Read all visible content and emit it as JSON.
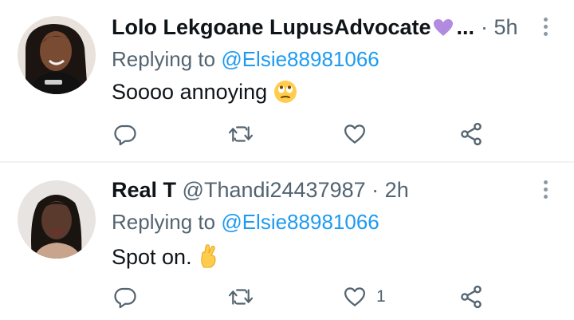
{
  "tweets": [
    {
      "display_name": "Lolo Lekgoane LupusAdvocate",
      "name_emoji": "purple-heart-emoji",
      "name_truncation": "...",
      "handle": "",
      "separator": "·",
      "time": "5h",
      "replying_prefix": "Replying to",
      "replying_handle": "@Elsie88981066",
      "text": "Soooo annoying",
      "text_emoji": "face-with-rolling-eyes-emoji",
      "like_count": ""
    },
    {
      "display_name": "Real T",
      "handle": "@Thandi24437987",
      "separator": "·",
      "time": "2h",
      "replying_prefix": "Replying to",
      "replying_handle": "@Elsie88981066",
      "text": "Spot on.",
      "text_emoji": "crossed-fingers-emoji",
      "like_count": "1"
    }
  ],
  "colors": {
    "link": "#1d9bf0",
    "secondary_text": "#536471",
    "icon": "#536471",
    "divider": "#eff3f4",
    "heart_emoji": "#b08be0"
  },
  "icons": {
    "reply": "reply-icon",
    "retweet": "retweet-icon",
    "like": "heart-icon",
    "share": "share-icon",
    "more": "more-icon"
  }
}
